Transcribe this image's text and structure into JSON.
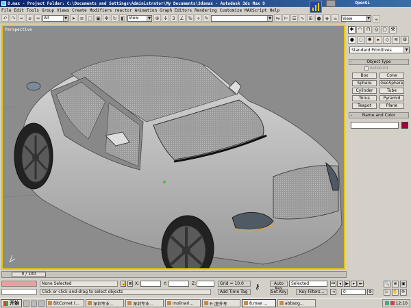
{
  "window": {
    "title": "8.max   - Project Folder: C:\\Documents and Settings\\Administrator\\My Documents\\3dsmax   - Autodesk 3ds Max 9",
    "renderer": "OpenGL"
  },
  "menu": [
    "File",
    "Edit",
    "Tools",
    "Group",
    "Views",
    "Create",
    "Modifiers",
    "reactor",
    "Animation",
    "Graph Editors",
    "Rendering",
    "Customize",
    "MAXScript",
    "Help"
  ],
  "toolbar": {
    "selection_filter": "All",
    "ref_coord": "View",
    "named_sel": "",
    "view_right": "View"
  },
  "viewport": {
    "label": "Perspective"
  },
  "command_panel": {
    "primitives_dropdown": "Standard Primitives",
    "object_type_title": "Object Type",
    "autogrid": "AutoGrid",
    "buttons": [
      "Box",
      "Cone",
      "Sphere",
      "GeoSphere",
      "Cylinder",
      "Tube",
      "Torus",
      "Pyramid",
      "Teapot",
      "Plane"
    ],
    "name_color_title": "Name and Color",
    "swatch_color": "#a0003c"
  },
  "timeline": {
    "slider": "0 / 100"
  },
  "status": {
    "selection": "None Selected",
    "prompt": "Click or click-and-drag to select objects",
    "x_label": "X:",
    "y_label": "Y:",
    "z_label": "Z:",
    "grid": "Grid = 10.0",
    "add_time_tag": "Add Time Tag",
    "auto_key": "Auto Key",
    "set_key": "Set Key",
    "key_mode": "Selected",
    "key_filters": "Key Filters...",
    "frame": "0"
  },
  "taskbar": {
    "start": "开始",
    "tasks": [
      "BitComet (...",
      "深圳专业...",
      "深圳专业...",
      "molinari...",
      "E:\\室外车",
      "8.max ...",
      "abbsog..."
    ],
    "clock": "12:10"
  }
}
